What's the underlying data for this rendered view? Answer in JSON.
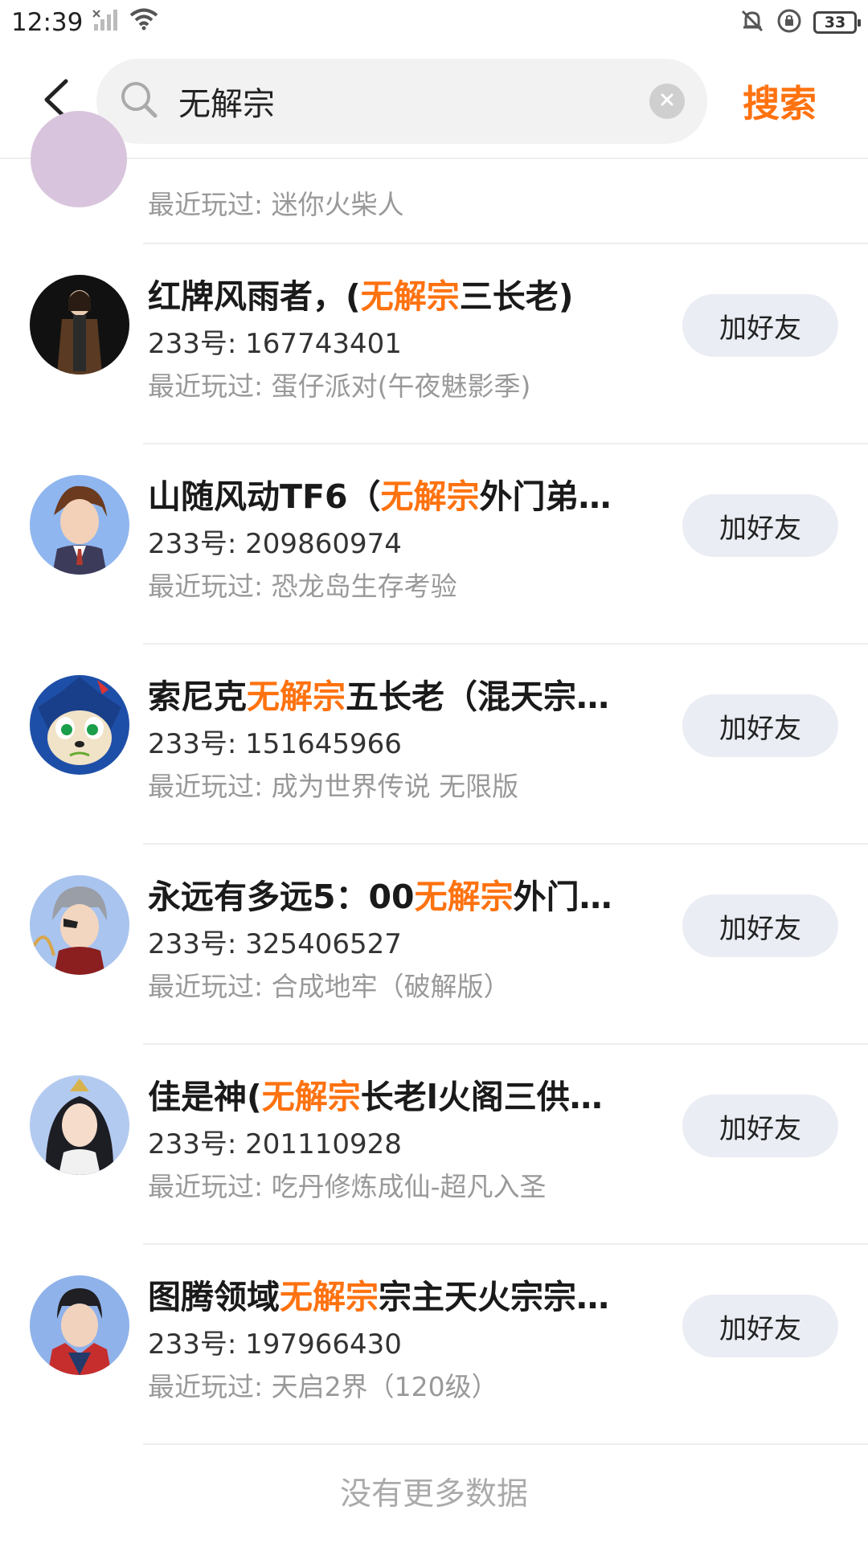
{
  "status_bar": {
    "time": "12:39",
    "battery": "33"
  },
  "search": {
    "query": "无解宗",
    "submit_label": "搜索"
  },
  "partial_item": {
    "recent_prefix": "最近玩过: ",
    "recent_game": "迷你火柴人"
  },
  "add_friend_label": "加好友",
  "id_prefix": "233号: ",
  "recent_prefix": "最近玩过: ",
  "users": [
    {
      "name_before": "红牌风雨者，(",
      "name_highlight": "无解宗",
      "name_after": "三长老)",
      "id": "167743401",
      "recent_game": "蛋仔派对(午夜魅影季)"
    },
    {
      "name_before": "山随风动TF6（",
      "name_highlight": "无解宗",
      "name_after": "外门弟…",
      "id": "209860974",
      "recent_game": "恐龙岛生存考验"
    },
    {
      "name_before": "索尼克",
      "name_highlight": "无解宗",
      "name_after": "五长老（混天宗…",
      "id": "151645966",
      "recent_game": "成为世界传说 无限版"
    },
    {
      "name_before": "永远有多远5：00",
      "name_highlight": "无解宗",
      "name_after": "外门…",
      "id": "325406527",
      "recent_game": "合成地牢（破解版）"
    },
    {
      "name_before": "佳是神(",
      "name_highlight": "无解宗",
      "name_after": "长老l火阁三供…",
      "id": "201110928",
      "recent_game": "吃丹修炼成仙-超凡入圣"
    },
    {
      "name_before": "图腾领域",
      "name_highlight": "无解宗",
      "name_after": "宗主天火宗宗…",
      "id": "197966430",
      "recent_game": "天启2界（120级）"
    }
  ],
  "footer": "没有更多数据",
  "colors": {
    "accent": "#ff7210",
    "button_bg": "#eaedf3",
    "muted_text": "#999999"
  }
}
